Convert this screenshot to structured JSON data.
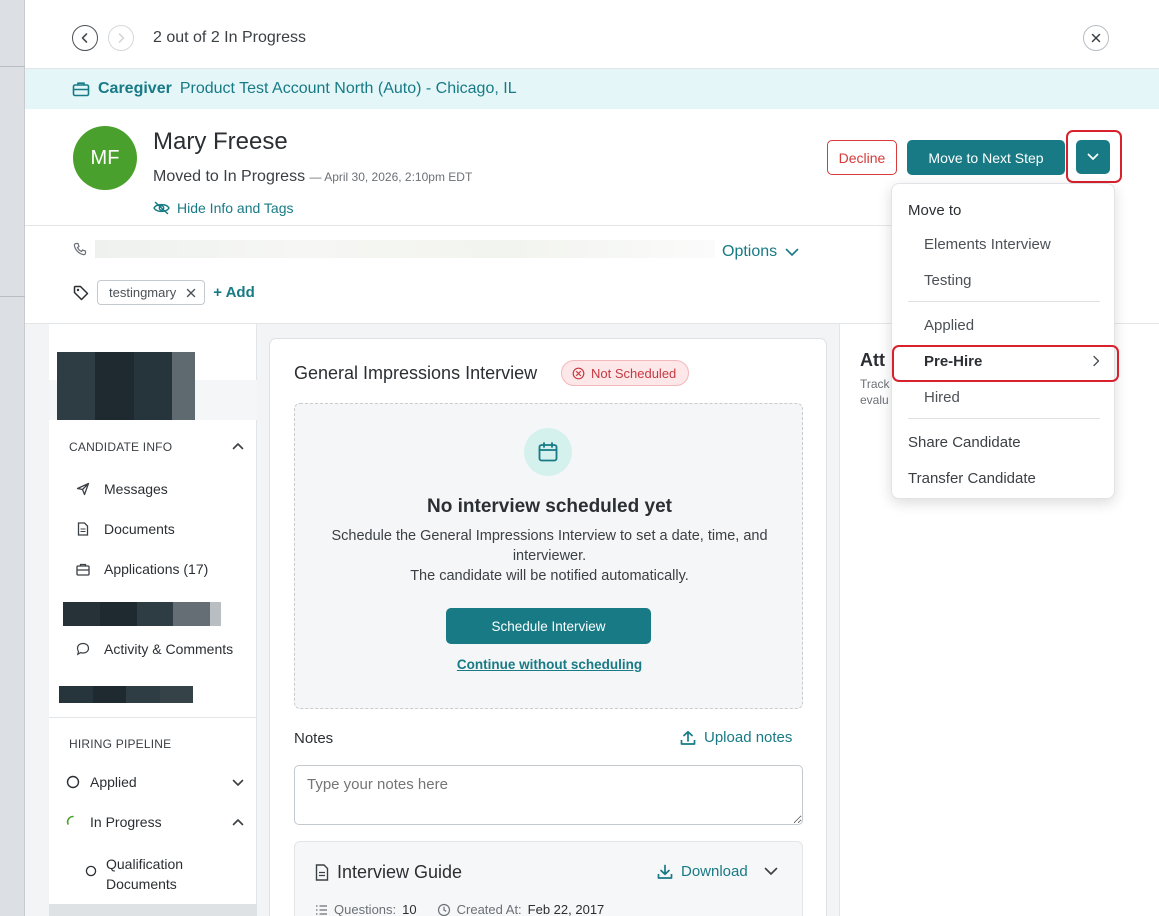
{
  "nav": {
    "count_text": "2 out of 2 In Progress"
  },
  "job": {
    "role": "Caregiver",
    "account": "Product Test Account North (Auto) - Chicago, IL"
  },
  "candidate": {
    "initials": "MF",
    "name": "Mary Freese",
    "status": "Moved to In Progress",
    "status_time": "— April 30, 2026, 2:10pm EDT",
    "hide_info_label": "Hide Info and Tags",
    "avatar_color": "#4aa02c"
  },
  "actions": {
    "decline_label": "Decline",
    "next_step_label": "Move to Next Step"
  },
  "contact": {
    "options_label": "Options"
  },
  "tags": {
    "items": [
      "testingmary"
    ],
    "add_label": "+ Add"
  },
  "sidebar": {
    "candidate_info_title": "CANDIDATE INFO",
    "items": [
      {
        "label": "Messages",
        "icon": "send-icon"
      },
      {
        "label": "Documents",
        "icon": "document-icon"
      },
      {
        "label": "Applications (17)",
        "icon": "briefcase-icon"
      },
      {
        "label": "Activity & Comments",
        "icon": "comment-icon"
      }
    ],
    "pipeline_title": "HIRING PIPELINE",
    "pipeline": [
      {
        "label": "Applied"
      },
      {
        "label": "In Progress"
      },
      {
        "label": "Qualification Documents"
      }
    ]
  },
  "interview": {
    "title": "General Impressions Interview",
    "badge": "Not Scheduled",
    "empty_heading": "No interview scheduled yet",
    "empty_line1": "Schedule the General Impressions Interview to set a date, time, and interviewer.",
    "empty_line2": "The candidate will be notified automatically.",
    "schedule_label": "Schedule Interview",
    "continue_label": "Continue without scheduling",
    "notes_label": "Notes",
    "upload_label": "Upload notes",
    "notes_placeholder": "Type your notes here",
    "guide_title": "Interview Guide",
    "download_label": "Download",
    "questions_label": "Questions:",
    "questions_value": "10",
    "created_label": "Created At:",
    "created_value": "Feb 22, 2017"
  },
  "right_panel": {
    "title": "Att",
    "sub1": "Track",
    "sub2": "evalu"
  },
  "menu": {
    "heading": "Move to",
    "group1": [
      "Elements Interview",
      "Testing"
    ],
    "group2": [
      "Applied",
      "Pre-Hire",
      "Hired"
    ],
    "group3": [
      "Share Candidate",
      "Transfer Candidate"
    ]
  },
  "colors": {
    "accent": "#177a85",
    "danger": "#d63a3a",
    "highlight": "#d8212c"
  }
}
